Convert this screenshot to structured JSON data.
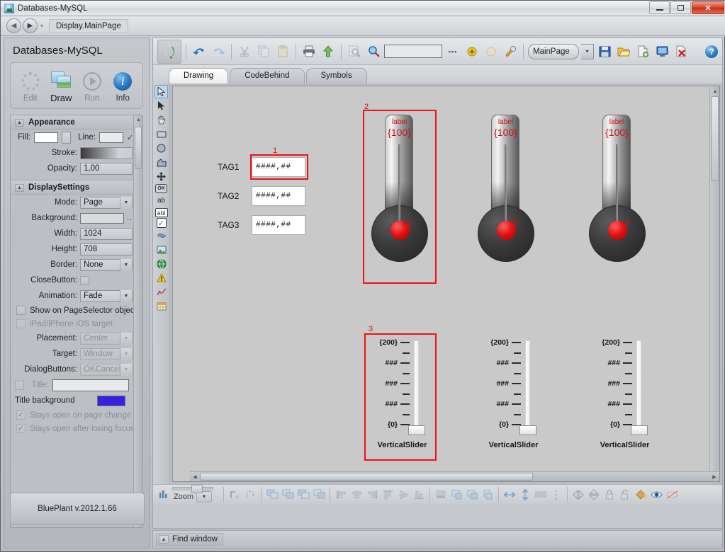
{
  "window": {
    "title": "Databases-MySQL",
    "app_icon": "app-database-icon",
    "minimize": "—",
    "maximize": "▣",
    "close": "✕"
  },
  "navbar": {
    "back_icon": "◀",
    "forward_icon": "▶",
    "dropdown_caret": "▾",
    "breadcrumb": "Display.MainPage"
  },
  "sidebar": {
    "project_title": "Databases-MySQL",
    "commands": [
      {
        "label": "Edit",
        "icon": "gear-icon",
        "state": "disabled"
      },
      {
        "label": "Draw",
        "icon": "draw-icon",
        "state": "active"
      },
      {
        "label": "Run",
        "icon": "run-icon",
        "state": "disabled"
      },
      {
        "label": "Info",
        "icon": "info-icon",
        "state": "normal"
      }
    ],
    "appearance": {
      "header": "Appearance",
      "collapse_icon": "▲",
      "fill_label": "Fill:",
      "fill_color": "#ffffff",
      "line_label": "Line:",
      "line_color": "#e8eaec",
      "line_checked": "✓",
      "stroke_label": "Stroke:",
      "opacity_label": "Opacity:",
      "opacity_value": "1,00"
    },
    "display_settings": {
      "header": "DisplaySettings",
      "collapse_icon": "▲",
      "rows": [
        {
          "label": "Mode:",
          "value": "Page",
          "type": "dropdown"
        },
        {
          "label": "Background:",
          "value": "",
          "type": "color",
          "color": "#d8dbde",
          "ellipsis": "..."
        },
        {
          "label": "Width:",
          "value": "1024",
          "type": "text"
        },
        {
          "label": "Height:",
          "value": "708",
          "type": "text"
        },
        {
          "label": "Border:",
          "value": "None",
          "type": "dropdown"
        },
        {
          "label": "CloseButton:",
          "value": "",
          "type": "checkbox"
        },
        {
          "label": "Animation:",
          "value": "Fade",
          "type": "dropdown"
        }
      ],
      "check_show_pageselector": "Show on PageSelector object",
      "check_ipad_target": "iPad/iPhone iOS target",
      "placement_label": "Placement:",
      "placement_value": "Center",
      "target_label": "Target:",
      "target_value": "Window",
      "dialogbuttons_label": "DialogButtons:",
      "dialogbuttons_value": "OKCancel",
      "title_label": "Title:",
      "title_value": "",
      "title_background_label": "Title background",
      "title_background_color": "#3720e0",
      "check_stays_open_page_change": "Stays open on page change",
      "check_stays_open_losing_focus": "Stays open after losing focus"
    },
    "version_badge": "BluePlant  v.2012.1.66"
  },
  "toolbar": {
    "refresh_icon": "refresh-icon",
    "items": [
      {
        "name": "undo-icon",
        "glyph": "↶",
        "state": "enabled"
      },
      {
        "name": "redo-icon",
        "glyph": "↷",
        "state": "enabled"
      },
      {
        "name": "cut-icon",
        "glyph": "✂",
        "state": "disabled"
      },
      {
        "name": "copy-icon",
        "glyph": "❐",
        "state": "disabled"
      },
      {
        "name": "paste-icon",
        "glyph": "📋",
        "state": "disabled"
      },
      {
        "name": "print-icon",
        "glyph": "🖶",
        "state": "enabled"
      },
      {
        "name": "upload-icon",
        "glyph": "⬆",
        "state": "enabled"
      },
      {
        "name": "find-icon",
        "glyph": "🔍",
        "state": "disabled"
      },
      {
        "name": "search-icon",
        "glyph": "🔍",
        "state": "enabled"
      }
    ],
    "search_value": "",
    "search_ellipsis": "...",
    "extra_icons": [
      {
        "name": "add-tag-icon",
        "glyph": "✦"
      },
      {
        "name": "remove-tag-icon",
        "glyph": "✧"
      },
      {
        "name": "build-icon",
        "glyph": "⚒"
      }
    ],
    "page_selector": "MainPage",
    "page_caret": "▾",
    "page_icons": [
      {
        "name": "save-icon",
        "glyph": "💾"
      },
      {
        "name": "open-folder-icon",
        "glyph": "📂"
      },
      {
        "name": "new-page-icon",
        "glyph": "📄"
      },
      {
        "name": "display-icon",
        "glyph": "🖥"
      },
      {
        "name": "delete-page-icon",
        "glyph": "✖"
      }
    ],
    "help_icon": "?"
  },
  "tabs": [
    {
      "label": "Drawing",
      "active": true
    },
    {
      "label": "CodeBehind",
      "active": false
    },
    {
      "label": "Symbols",
      "active": false
    }
  ],
  "drawing_tools": [
    {
      "name": "select-arrow-tool",
      "glyph": "↖",
      "selected": true
    },
    {
      "name": "pointer-tool",
      "glyph": "➤",
      "selected": false
    },
    {
      "name": "pan-hand-tool",
      "glyph": "✋",
      "selected": false
    },
    {
      "name": "rectangle-tool",
      "glyph": "▭",
      "selected": false
    },
    {
      "name": "ellipse-tool",
      "glyph": "●",
      "selected": false
    },
    {
      "name": "polygon-tool",
      "glyph": "⬟",
      "selected": false
    },
    {
      "name": "move-tool",
      "glyph": "✛",
      "selected": false
    },
    {
      "name": "button-tool",
      "glyph": "OK",
      "selected": false
    },
    {
      "name": "text-label-tool",
      "glyph": "ab",
      "selected": false
    },
    {
      "name": "textbox-tool",
      "glyph": "abl",
      "selected": false
    },
    {
      "name": "checkbox-tool",
      "glyph": "✓",
      "selected": false
    },
    {
      "name": "link-tool",
      "glyph": "⚭",
      "selected": false
    },
    {
      "name": "image-tool",
      "glyph": "🖼",
      "selected": false
    },
    {
      "name": "globe-browser-tool",
      "glyph": "🌐",
      "selected": false
    },
    {
      "name": "alarm-tool",
      "glyph": "⚠",
      "selected": false
    },
    {
      "name": "trend-tool",
      "glyph": "📈",
      "selected": false
    },
    {
      "name": "datagrid-tool",
      "glyph": "▦",
      "selected": false
    }
  ],
  "canvas": {
    "background": "#c9c9c9",
    "selection_color": "#ee1111",
    "tag_rows": [
      {
        "label": "TAG1",
        "value": "####,##",
        "selected": true,
        "selection_number": "1"
      },
      {
        "label": "TAG2",
        "value": "####,##",
        "selected": false,
        "selection_number": ""
      },
      {
        "label": "TAG3",
        "value": "####,##",
        "selected": false,
        "selection_number": ""
      }
    ],
    "thermometers": [
      {
        "label": "label",
        "max_value": "{100}",
        "min_value": "{0}",
        "selected": true,
        "selection_number": "2"
      },
      {
        "label": "label",
        "max_value": "{100}",
        "min_value": "{0}",
        "selected": false,
        "selection_number": ""
      },
      {
        "label": "label",
        "max_value": "{100}",
        "min_value": "{0}",
        "selected": false,
        "selection_number": ""
      }
    ],
    "sliders": [
      {
        "caption": "VerticalSlider",
        "ticks": [
          "{200}",
          "",
          "###",
          "",
          "###",
          "",
          "###",
          "",
          "{0}"
        ],
        "selected": true,
        "selection_number": "3"
      },
      {
        "caption": "VerticalSlider",
        "ticks": [
          "{200}",
          "",
          "###",
          "",
          "###",
          "",
          "###",
          "",
          "{0}"
        ],
        "selected": false,
        "selection_number": ""
      },
      {
        "caption": "VerticalSlider",
        "ticks": [
          "{200}",
          "",
          "###",
          "",
          "###",
          "",
          "###",
          "",
          "{0}"
        ],
        "selected": false,
        "selection_number": ""
      }
    ]
  },
  "bottom_toolbar": {
    "zoom_icon": "zoom-bars-icon",
    "zoom_label": "Zoom",
    "zoom_caret": "▾",
    "align_buttons": [
      {
        "name": "snap-grid-icon",
        "glyph": "▨"
      },
      {
        "name": "rotate-icon",
        "glyph": "⟳"
      },
      {
        "name": "group-icon",
        "glyph": "❏"
      },
      {
        "name": "ungroup-icon",
        "glyph": "❐"
      },
      {
        "name": "bring-front-icon",
        "glyph": "❒"
      },
      {
        "name": "send-back-icon",
        "glyph": "❏"
      },
      {
        "name": "align-left-icon",
        "glyph": "⊢"
      },
      {
        "name": "align-center-icon",
        "glyph": "⊥"
      },
      {
        "name": "align-right-icon",
        "glyph": "⊣"
      },
      {
        "name": "align-top-icon",
        "glyph": "⊤"
      },
      {
        "name": "align-middle-icon",
        "glyph": "⊜"
      },
      {
        "name": "align-bottom-icon",
        "glyph": "⊥"
      },
      {
        "name": "distribute-h-icon",
        "glyph": "⫶"
      },
      {
        "name": "same-width-icon",
        "glyph": "⬓"
      },
      {
        "name": "same-height-icon",
        "glyph": "⬒"
      },
      {
        "name": "same-size-icon",
        "glyph": "⬔"
      },
      {
        "name": "resize-h-icon",
        "glyph": "↔"
      },
      {
        "name": "resize-v-icon",
        "glyph": "↕"
      },
      {
        "name": "spacing-icon",
        "glyph": "▮▮"
      },
      {
        "name": "spacing-v-icon",
        "glyph": "⋮"
      },
      {
        "name": "flip-h-icon",
        "glyph": "⋈"
      },
      {
        "name": "flip-v-icon",
        "glyph": "⧖"
      },
      {
        "name": "lock-icon",
        "glyph": "🔒"
      },
      {
        "name": "unlock-icon",
        "glyph": "🔓"
      },
      {
        "name": "paint-icon",
        "glyph": "🎨"
      },
      {
        "name": "preview-eye-icon",
        "glyph": "👁"
      },
      {
        "name": "hide-icon",
        "glyph": "👁"
      }
    ]
  },
  "dock": {
    "find_window_label": "Find window",
    "expand_icon": "▲"
  }
}
